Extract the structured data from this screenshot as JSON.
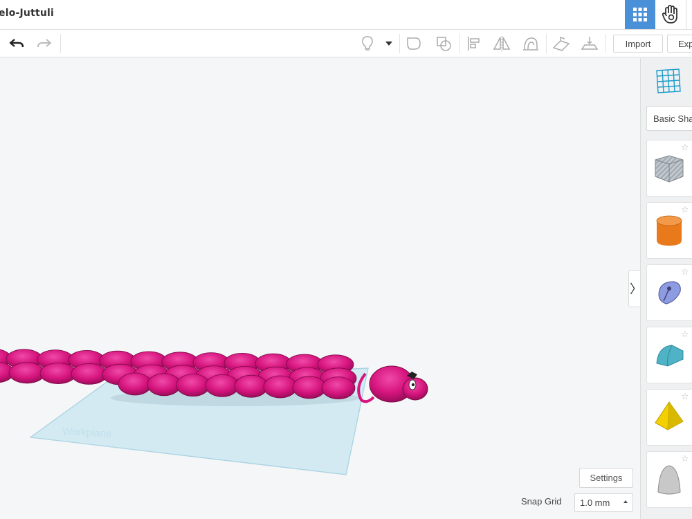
{
  "header": {
    "title": "elo-Juttuli",
    "grid_view_icon": "grid-view-icon",
    "hand_icon": "hand-icon"
  },
  "toolbar": {
    "undo_icon": "undo-icon",
    "redo_icon": "redo-icon",
    "tools": [
      "lightbulb-icon",
      "dropdown-caret-icon",
      "group-icon",
      "ungroup-icon",
      "align-icon",
      "mirror-icon",
      "cruise-icon",
      "workplane-icon",
      "ruler-icon"
    ],
    "import_label": "Import",
    "export_label": "Exp"
  },
  "workspace": {
    "workplane_label": "Workplane",
    "workplane_color": "#cde8f2",
    "model_color": "#d6157e"
  },
  "footer": {
    "settings_label": "Settings",
    "snap_grid_label": "Snap Grid",
    "snap_grid_value": "1.0 mm"
  },
  "panel": {
    "grid_icon": "workplane-grid-icon",
    "category_label": "Basic Sha",
    "collapse_glyph": "〉",
    "shapes": [
      {
        "name": "box-hole",
        "color": "#9aa3ab"
      },
      {
        "name": "cylinder",
        "color": "#e87a1c"
      },
      {
        "name": "polygon-shape",
        "color": "#8d9be0"
      },
      {
        "name": "roof",
        "color": "#4fb3c6"
      },
      {
        "name": "pyramid",
        "color": "#f5d000"
      },
      {
        "name": "paraboloid",
        "color": "#c8c8c8"
      }
    ]
  }
}
